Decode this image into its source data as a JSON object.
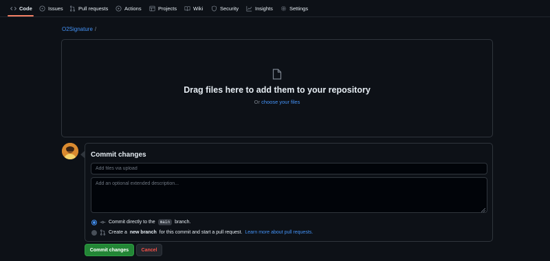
{
  "nav": {
    "items": [
      {
        "label": "Code",
        "icon": "code-icon"
      },
      {
        "label": "Issues",
        "icon": "issue-opened-icon"
      },
      {
        "label": "Pull requests",
        "icon": "git-pull-request-icon"
      },
      {
        "label": "Actions",
        "icon": "play-icon"
      },
      {
        "label": "Projects",
        "icon": "table-icon"
      },
      {
        "label": "Wiki",
        "icon": "book-icon"
      },
      {
        "label": "Security",
        "icon": "shield-icon"
      },
      {
        "label": "Insights",
        "icon": "graph-icon"
      },
      {
        "label": "Settings",
        "icon": "gear-icon"
      }
    ],
    "active": "Code"
  },
  "breadcrumb": {
    "repo": "O2Signature",
    "separator": "/"
  },
  "dropzone": {
    "title": "Drag files here to add them to your repository",
    "or_text": "Or",
    "link_text": "choose your files"
  },
  "commit": {
    "title": "Commit changes",
    "summary_placeholder": "Add files via upload",
    "description_placeholder": "Add an optional extended description...",
    "option_direct": {
      "prefix": "Commit directly to the",
      "branch": "main",
      "suffix": "branch."
    },
    "option_new_branch": {
      "prefix": "Create a",
      "bold": "new branch",
      "suffix": "for this commit and start a pull request.",
      "link": "Learn more about pull requests."
    },
    "commit_button": "Commit changes",
    "cancel_button": "Cancel"
  },
  "colors": {
    "background": "#0d1117",
    "border": "#30363d",
    "link": "#4493f8",
    "primary_button": "#238636",
    "danger_text": "#f85149",
    "active_tab_underline": "#f78166"
  }
}
